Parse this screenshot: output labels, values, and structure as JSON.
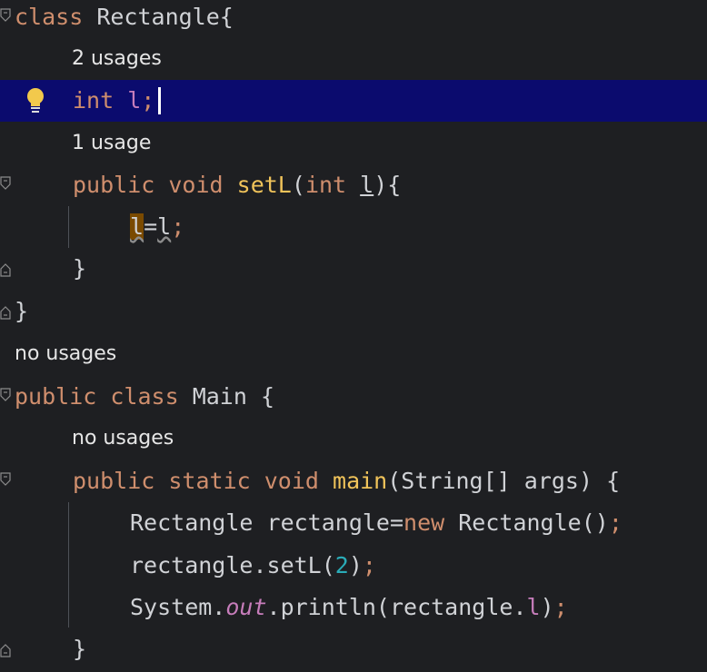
{
  "editor": {
    "language": "Java",
    "lines": [
      {
        "tokens": [
          {
            "t": "class",
            "c": "kw"
          },
          {
            "t": " Rectangle{",
            "c": "txt"
          }
        ]
      },
      {
        "hint": "2 usages"
      },
      {
        "tokens": [
          {
            "t": "int",
            "c": "kw"
          },
          {
            "t": " ",
            "c": "txt"
          },
          {
            "t": "l",
            "c": "fld"
          },
          {
            "t": ";",
            "c": "semi"
          }
        ],
        "current": true
      },
      {
        "hint": "1 usage"
      },
      {
        "tokens": [
          {
            "t": "public",
            "c": "kw"
          },
          {
            "t": " ",
            "c": "txt"
          },
          {
            "t": "void",
            "c": "kw"
          },
          {
            "t": " ",
            "c": "txt"
          },
          {
            "t": "setL",
            "c": "fn"
          },
          {
            "t": "(",
            "c": "txt"
          },
          {
            "t": "int",
            "c": "kw"
          },
          {
            "t": " ",
            "c": "txt"
          },
          {
            "t": "l",
            "c": "txt ul"
          },
          {
            "t": "){",
            "c": "txt"
          }
        ]
      },
      {
        "tokens": [
          {
            "t": "l",
            "c": "txt hl param"
          },
          {
            "t": "=",
            "c": "txt"
          },
          {
            "t": "l",
            "c": "txt param"
          },
          {
            "t": ";",
            "c": "semi"
          }
        ]
      },
      {
        "tokens": [
          {
            "t": "}",
            "c": "txt"
          }
        ]
      },
      {
        "tokens": [
          {
            "t": "}",
            "c": "txt"
          }
        ]
      },
      {
        "hint": "no usages"
      },
      {
        "tokens": [
          {
            "t": "public",
            "c": "kw"
          },
          {
            "t": " ",
            "c": "txt"
          },
          {
            "t": "class",
            "c": "kw"
          },
          {
            "t": " Main {",
            "c": "txt"
          }
        ]
      },
      {
        "hint": "no usages"
      },
      {
        "tokens": [
          {
            "t": "public",
            "c": "kw"
          },
          {
            "t": " ",
            "c": "txt"
          },
          {
            "t": "static",
            "c": "kw"
          },
          {
            "t": " ",
            "c": "txt"
          },
          {
            "t": "void",
            "c": "kw"
          },
          {
            "t": " ",
            "c": "txt"
          },
          {
            "t": "main",
            "c": "fn"
          },
          {
            "t": "(String[] args) {",
            "c": "txt"
          }
        ]
      },
      {
        "tokens": [
          {
            "t": "Rectangle rectangle=",
            "c": "txt"
          },
          {
            "t": "new",
            "c": "kw"
          },
          {
            "t": " Rectangle()",
            "c": "txt"
          },
          {
            "t": ";",
            "c": "semi"
          }
        ]
      },
      {
        "tokens": [
          {
            "t": "rectangle.setL(",
            "c": "txt"
          },
          {
            "t": "2",
            "c": "num"
          },
          {
            "t": ")",
            "c": "txt"
          },
          {
            "t": ";",
            "c": "semi"
          }
        ]
      },
      {
        "tokens": [
          {
            "t": "System.",
            "c": "txt"
          },
          {
            "t": "out",
            "c": "out"
          },
          {
            "t": ".println(rectangle.",
            "c": "txt"
          },
          {
            "t": "l",
            "c": "fld"
          },
          {
            "t": ")",
            "c": "txt"
          },
          {
            "t": ";",
            "c": "semi"
          }
        ]
      },
      {
        "tokens": [
          {
            "t": "}",
            "c": "txt"
          }
        ]
      }
    ],
    "icons": {
      "intention": "lightbulb-icon",
      "fold_open": "fold-open-icon",
      "fold_close": "fold-close-icon"
    },
    "colors": {
      "background": "#1e1f22",
      "current_line": "#0b0b6e",
      "keyword": "#cf8e6d",
      "function": "#f0c35a",
      "field": "#c77dbb",
      "number": "#2aacb8",
      "text": "#d0d2d6"
    }
  }
}
